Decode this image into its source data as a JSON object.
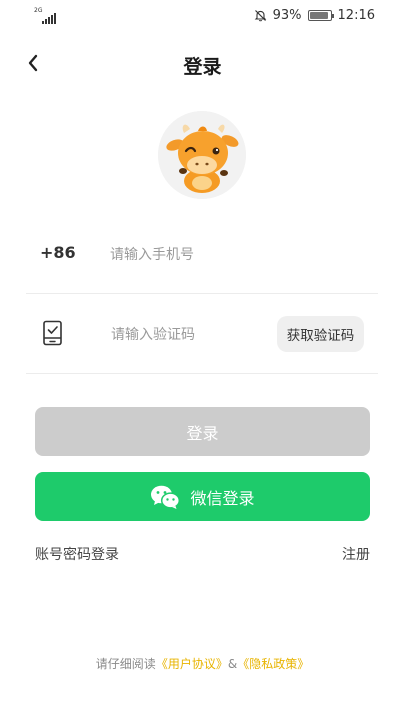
{
  "status_bar": {
    "network": "2G",
    "battery_percent": "93%",
    "battery_level": 0.93,
    "time": "12:16"
  },
  "header": {
    "title": "登录",
    "back_icon": "chevron-left-icon"
  },
  "phone_field": {
    "prefix": "+86",
    "placeholder": "请输入手机号"
  },
  "code_field": {
    "placeholder": "请输入验证码",
    "icon": "phone-check-icon",
    "get_code_label": "获取验证码"
  },
  "buttons": {
    "login_label": "登录",
    "wechat_label": "微信登录",
    "wechat_icon": "wechat-icon"
  },
  "links": {
    "password_login": "账号密码登录",
    "register": "注册"
  },
  "agreement": {
    "prefix": "请仔细阅读",
    "user_agreement": "《用户协议》",
    "separator": "&",
    "privacy_policy": "《隐私政策》"
  },
  "colors": {
    "primary_green": "#1ecb6b",
    "disabled_gray": "#cccccc",
    "link_yellow": "#e8b400"
  }
}
